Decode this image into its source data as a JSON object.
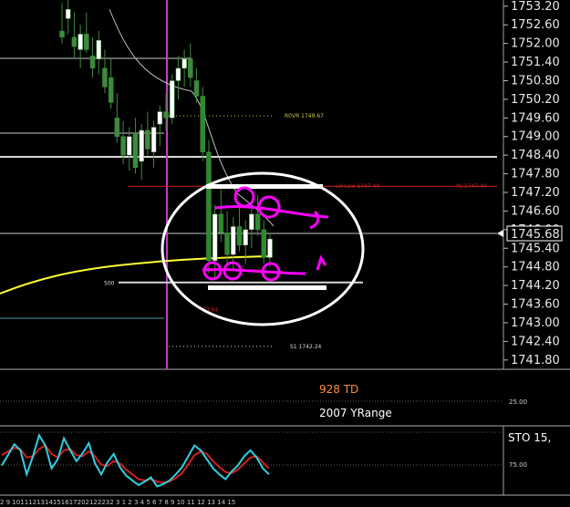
{
  "chart_data": {
    "type": "candlestick",
    "price_axis": {
      "ticks": [
        "1753.20",
        "1752.60",
        "1752.00",
        "1751.40",
        "1750.80",
        "1750.20",
        "1749.60",
        "1749.00",
        "1748.40",
        "1747.80",
        "1747.20",
        "1746.60",
        "1746.00",
        "1745.40",
        "1744.80",
        "1744.20",
        "1743.60",
        "1743.00",
        "1742.40",
        "1741.80"
      ],
      "current_price": "1745.68",
      "ylim": [
        1741.5,
        1753.4
      ]
    },
    "levels": [
      {
        "label": "R0VR 1749.67",
        "value": 1749.67,
        "color": "#c8c84a"
      },
      {
        "label": "LH Low 1747.40",
        "value": 1747.4,
        "color": "#d02020"
      },
      {
        "label": "YL 1747.40",
        "value": 1747.4,
        "color": "#d02020"
      },
      {
        "label": "500",
        "value": 1744.3,
        "color": "#d8d8d8"
      },
      {
        "label": "73.94",
        "value": 1743.6,
        "color": "#d02020"
      },
      {
        "label": "S1 1742.24",
        "value": 1742.24,
        "color": "#d8d8d8"
      }
    ],
    "candles": [
      {
        "o": 1752.4,
        "h": 1753.3,
        "l": 1752.0,
        "c": 1752.2
      },
      {
        "o": 1752.8,
        "h": 1753.4,
        "l": 1752.3,
        "c": 1753.1
      },
      {
        "o": 1752.2,
        "h": 1753.0,
        "l": 1751.5,
        "c": 1751.9
      },
      {
        "o": 1751.8,
        "h": 1752.6,
        "l": 1751.2,
        "c": 1752.3
      },
      {
        "o": 1752.3,
        "h": 1753.0,
        "l": 1751.7,
        "c": 1751.8
      },
      {
        "o": 1751.6,
        "h": 1752.2,
        "l": 1750.9,
        "c": 1751.2
      },
      {
        "o": 1751.5,
        "h": 1752.4,
        "l": 1751.0,
        "c": 1752.1
      },
      {
        "o": 1751.2,
        "h": 1751.8,
        "l": 1750.4,
        "c": 1750.6
      },
      {
        "o": 1750.9,
        "h": 1751.5,
        "l": 1749.9,
        "c": 1750.1
      },
      {
        "o": 1749.6,
        "h": 1750.4,
        "l": 1748.8,
        "c": 1749.0
      },
      {
        "o": 1749.0,
        "h": 1749.5,
        "l": 1748.1,
        "c": 1748.4
      },
      {
        "o": 1748.4,
        "h": 1749.3,
        "l": 1747.9,
        "c": 1749.0
      },
      {
        "o": 1749.1,
        "h": 1749.6,
        "l": 1747.8,
        "c": 1748.0
      },
      {
        "o": 1748.2,
        "h": 1749.4,
        "l": 1747.6,
        "c": 1749.2
      },
      {
        "o": 1749.2,
        "h": 1749.8,
        "l": 1748.4,
        "c": 1748.6
      },
      {
        "o": 1748.5,
        "h": 1749.5,
        "l": 1748.0,
        "c": 1749.3
      },
      {
        "o": 1749.4,
        "h": 1750.0,
        "l": 1748.7,
        "c": 1749.8
      },
      {
        "o": 1749.8,
        "h": 1750.4,
        "l": 1749.2,
        "c": 1749.6
      },
      {
        "o": 1749.6,
        "h": 1751.0,
        "l": 1749.4,
        "c": 1750.8
      },
      {
        "o": 1750.8,
        "h": 1751.6,
        "l": 1750.2,
        "c": 1751.2
      },
      {
        "o": 1751.2,
        "h": 1751.8,
        "l": 1750.6,
        "c": 1751.5
      },
      {
        "o": 1751.5,
        "h": 1752.0,
        "l": 1750.6,
        "c": 1750.9
      },
      {
        "o": 1750.8,
        "h": 1751.2,
        "l": 1750.1,
        "c": 1750.3
      },
      {
        "o": 1750.3,
        "h": 1750.6,
        "l": 1748.2,
        "c": 1748.5
      },
      {
        "o": 1748.5,
        "h": 1748.9,
        "l": 1744.6,
        "c": 1745.0
      },
      {
        "o": 1745.0,
        "h": 1746.8,
        "l": 1744.4,
        "c": 1746.5
      },
      {
        "o": 1746.5,
        "h": 1747.3,
        "l": 1745.6,
        "c": 1745.9
      },
      {
        "o": 1745.9,
        "h": 1746.6,
        "l": 1744.9,
        "c": 1745.2
      },
      {
        "o": 1745.2,
        "h": 1746.4,
        "l": 1744.7,
        "c": 1746.1
      },
      {
        "o": 1746.1,
        "h": 1746.7,
        "l": 1745.3,
        "c": 1745.5
      },
      {
        "o": 1745.5,
        "h": 1746.3,
        "l": 1744.9,
        "c": 1746.0
      },
      {
        "o": 1746.0,
        "h": 1746.8,
        "l": 1745.4,
        "c": 1746.5
      },
      {
        "o": 1746.5,
        "h": 1747.1,
        "l": 1745.8,
        "c": 1746.0
      },
      {
        "o": 1746.0,
        "h": 1746.3,
        "l": 1744.9,
        "c": 1745.1
      },
      {
        "o": 1745.1,
        "h": 1745.9,
        "l": 1744.8,
        "c": 1745.7
      }
    ],
    "indicators": {
      "td_label": "928 TD",
      "yrange_label": "2007 YRange",
      "td_tick": "25.00",
      "sto_label": "STO  15,",
      "sto_tick": "75.00",
      "sto_k": [
        45,
        62,
        80,
        70,
        30,
        60,
        95,
        78,
        40,
        55,
        90,
        70,
        52,
        65,
        82,
        48,
        30,
        50,
        64,
        42,
        28,
        20,
        12,
        18,
        25,
        10,
        14,
        20,
        30,
        42,
        60,
        78,
        70,
        55,
        40,
        30,
        22,
        35,
        45,
        60,
        70,
        58,
        40,
        30
      ],
      "sto_d": [
        62,
        68,
        74,
        72,
        58,
        60,
        72,
        78,
        64,
        58,
        70,
        72,
        62,
        60,
        68,
        60,
        46,
        44,
        52,
        48,
        38,
        30,
        22,
        20,
        22,
        18,
        16,
        18,
        24,
        32,
        46,
        62,
        68,
        64,
        52,
        42,
        34,
        32,
        38,
        48,
        58,
        60,
        50,
        40
      ]
    },
    "time_axis_labels": "2  9 1011121314151617202122232  3  1  2  3  4  5  6  7  8  9 10 11 12 13 14 15"
  },
  "annotations": {
    "ellipse_color": "#ffffff",
    "marker_color": "#ff00ff"
  }
}
